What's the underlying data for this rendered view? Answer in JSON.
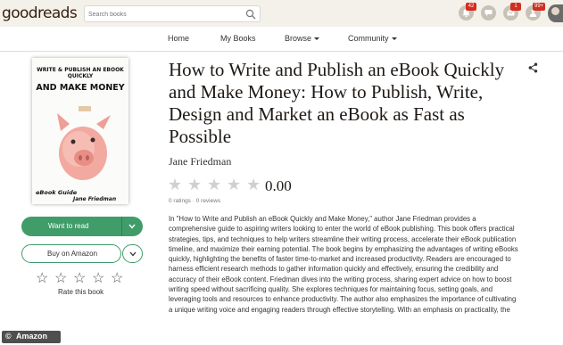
{
  "header": {
    "logo": "goodreads",
    "search_placeholder": "Search books",
    "badges": {
      "notifications": "42",
      "messages": "1",
      "friends": "99+"
    }
  },
  "nav": {
    "home": "Home",
    "my_books": "My Books",
    "browse": "Browse",
    "community": "Community"
  },
  "book": {
    "cover": {
      "title_line": "WRITE & PUBLISH AN EBOOK QUICKLY",
      "subtitle_line": "AND MAKE MONEY",
      "footer_line1": "eBook Guide",
      "footer_line2": "Jane Friedman"
    },
    "title": "How to Write and Publish an eBook Quickly and Make Money: How to Publish, Write, Design and Market an eBook as Fast as Possible",
    "author": "Jane Friedman",
    "average_rating": "0.00",
    "ratings_count": "0 ratings",
    "reviews_count": "0 reviews",
    "description": "In \"How to Write and Publish an eBook Quickly and Make Money,\" author Jane Friedman provides a comprehensive guide to aspiring writers looking to enter the world of eBook publishing. This book offers practical strategies, tips, and techniques to help writers streamline their writing process, accelerate their eBook publication timeline, and maximize their earning potential. The book begins by emphasizing the advantages of writing eBooks quickly, highlighting the benefits of faster time-to-market and increased productivity. Readers are encouraged to harness efficient research methods to gather information quickly and effectively, ensuring the credibility and accuracy of their eBook content. Friedman dives into the writing process, sharing expert advice on how to boost writing speed without sacrificing quality. She explores techniques for maintaining focus, setting goals, and leveraging tools and resources to enhance productivity. The author also emphasizes the importance of cultivating a unique writing voice and engaging readers through effective storytelling. With an emphasis on practicality, the"
  },
  "actions": {
    "want_to_read": "Want to read",
    "buy_on_amazon": "Buy on Amazon",
    "rate_this_book": "Rate this book"
  },
  "watermark": {
    "symbol": "©",
    "text": "Amazon"
  },
  "icons": [
    "search-icon",
    "notifications-icon",
    "messages-icon",
    "inbox-icon",
    "friends-icon",
    "share-icon",
    "chevron-down-icon",
    "star-icon"
  ],
  "colors": {
    "header_bg": "#f4f1ea",
    "primary_green": "#409d69",
    "badge_red": "#d12d20",
    "star_empty": "#d0d0d0"
  }
}
